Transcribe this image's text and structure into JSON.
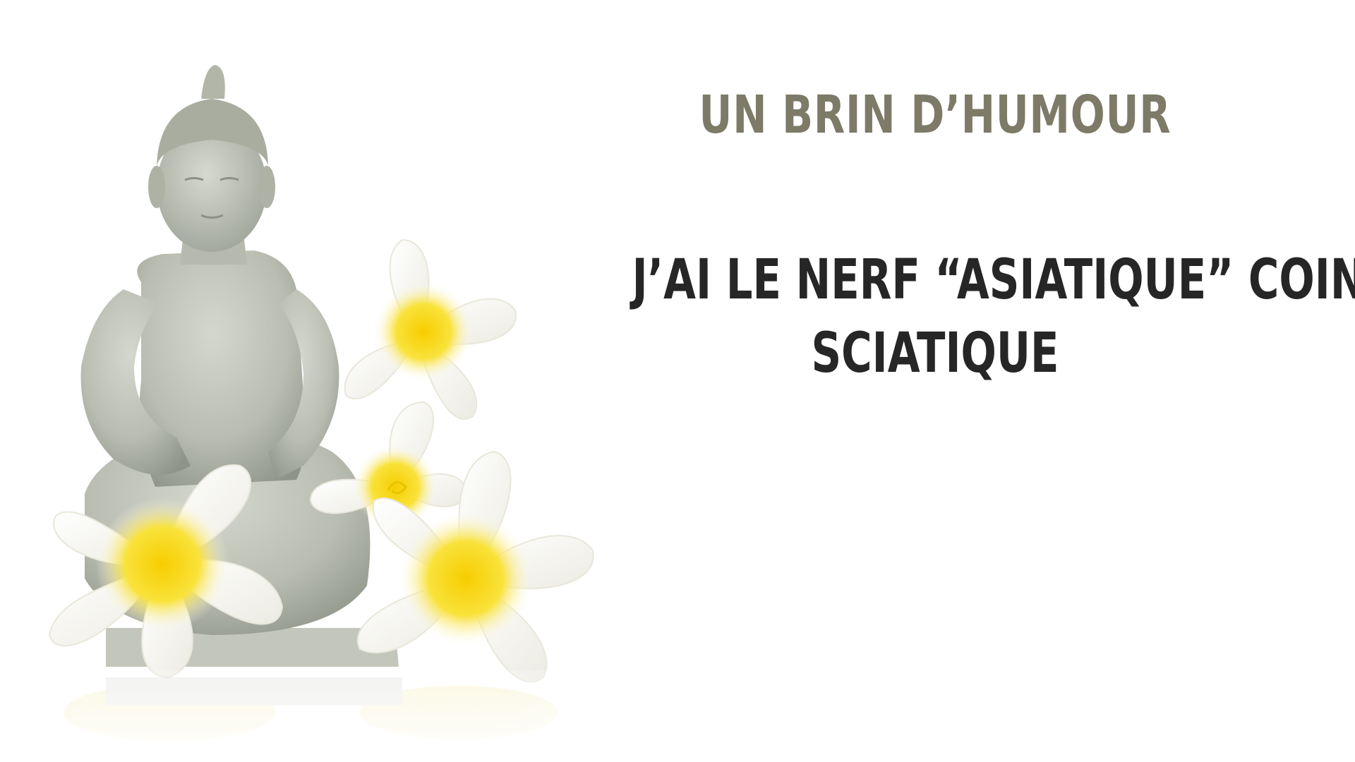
{
  "heading": {
    "text": "UN BRIN D’HUMOUR",
    "color": "#7d7a68"
  },
  "joke": {
    "line1": "J’AI LE NERF “ASIATIQUE” COINCÉ.",
    "line2": "SCIATIQUE",
    "color": "#262626"
  },
  "image": {
    "subject": "buddha-statue-with-frangipani-flowers",
    "statue_color": "#bcc0b4",
    "petal_color": "#fbfaf6",
    "flower_center_color": "#f6d400"
  }
}
